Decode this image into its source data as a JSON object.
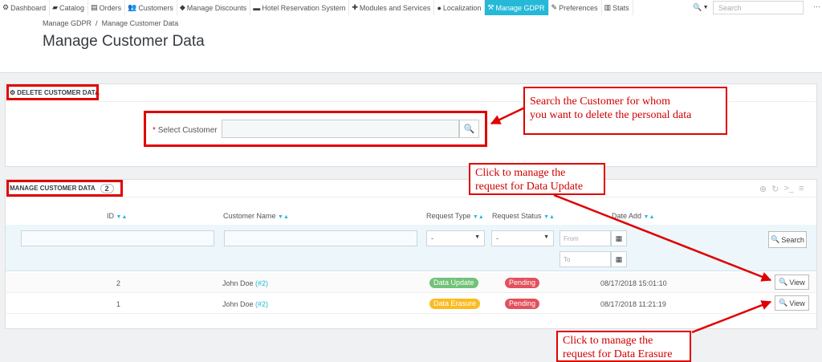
{
  "nav": {
    "items": [
      {
        "icon": "dashboard-icon",
        "glyph": "⚙",
        "label": "Dashboard"
      },
      {
        "icon": "catalog-icon",
        "glyph": "▰",
        "label": "Catalog"
      },
      {
        "icon": "orders-icon",
        "glyph": "▤",
        "label": "Orders"
      },
      {
        "icon": "customers-icon",
        "glyph": "👥",
        "label": "Customers"
      },
      {
        "icon": "discounts-icon",
        "glyph": "◆",
        "label": "Manage Discounts"
      },
      {
        "icon": "hotel-icon",
        "glyph": "▬",
        "label": "Hotel Reservation System"
      },
      {
        "icon": "modules-icon",
        "glyph": "✚",
        "label": "Modules and Services"
      },
      {
        "icon": "localization-icon",
        "glyph": "●",
        "label": "Localization"
      },
      {
        "icon": "gdpr-icon",
        "glyph": "⚒",
        "label": "Manage GDPR"
      },
      {
        "icon": "preferences-icon",
        "glyph": "✎",
        "label": "Preferences"
      },
      {
        "icon": "stats-icon",
        "glyph": "▥",
        "label": "Stats"
      }
    ],
    "active_index": 8,
    "search_placeholder": "Search",
    "more": "···"
  },
  "header": {
    "breadcrumb": [
      "Manage GDPR",
      "Manage Customer Data"
    ],
    "breadcrumb_sep": "/",
    "title": "Manage Customer Data"
  },
  "delete_panel": {
    "title": "DELETE CUSTOMER DATA",
    "select_label": "Select Customer",
    "required_mark": "*",
    "select_value": ""
  },
  "manage_panel": {
    "title": "MANAGE CUSTOMER DATA",
    "count": "2",
    "columns": [
      "ID",
      "Customer Name",
      "Request Type",
      "Request Status",
      "Date Add"
    ],
    "filters": {
      "request_type": "-",
      "request_status": "-",
      "date_from_placeholder": "From",
      "date_to_placeholder": "To",
      "search_label": "Search"
    },
    "rows": [
      {
        "id": "2",
        "customer": "John Doe",
        "customer_ref": "(#2)",
        "request_type": "Data Update",
        "request_status": "Pending",
        "date_add": "08/17/2018 15:01:10",
        "action": "View"
      },
      {
        "id": "1",
        "customer": "John Doe",
        "customer_ref": "(#2)",
        "request_type": "Data Erasure",
        "request_status": "Pending",
        "date_add": "08/17/2018 11:21:19",
        "action": "View"
      }
    ]
  },
  "annotations": {
    "search_callout": [
      "Search the Customer for whom",
      "you want to delete the personal data"
    ],
    "update_callout": [
      "Click to manage the",
      "request for Data Update"
    ],
    "erasure_callout": [
      "Click to manage the",
      "request for Data Erasure"
    ],
    "color": "#e00000"
  },
  "colors": {
    "accent": "#25b9d7",
    "update_badge": "#72c279",
    "erasure_badge": "#fbbb22",
    "pending_badge": "#e2515d"
  }
}
